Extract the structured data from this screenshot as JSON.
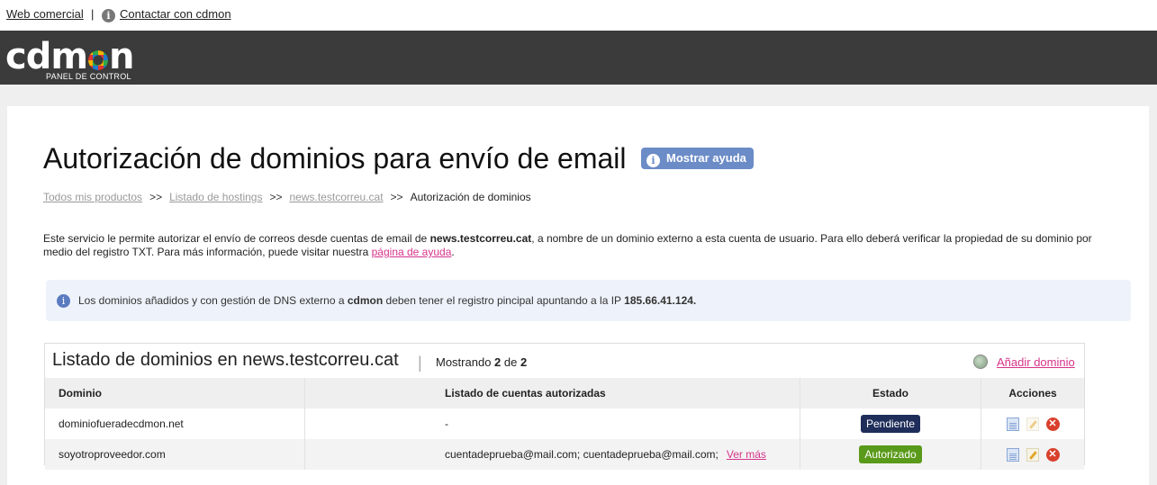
{
  "top_links": {
    "web": "Web comercial",
    "separator": "|",
    "contact": "Contactar con cdmon"
  },
  "header": {
    "logo_left": "cdm",
    "logo_right": "n",
    "subtitle": "PANEL DE CONTROL"
  },
  "page": {
    "title": "Autorización de dominios para envío de email",
    "help_button": "Mostrar ayuda"
  },
  "breadcrumb": {
    "items": [
      "Todos mis productos",
      "Listado de hostings",
      "news.testcorreu.cat"
    ],
    "separator": ">>",
    "current": "Autorización de dominios"
  },
  "description": {
    "part1": "Este servicio le permite autorizar el envío de correos desde cuentas de email de ",
    "domain": "news.testcorreu.cat",
    "part2": ", a nombre de un dominio externo a esta cuenta de usuario. Para ello deberá verificar la propiedad de su dominio por medio del registro TXT. Para más información, puede visitar nuestra ",
    "link": "página de ayuda",
    "part3": "."
  },
  "notice": {
    "part1": "Los dominios añadidos y con gestión de DNS externo a ",
    "brand": "cdmon",
    "part2": " deben tener el registro pincipal apuntando a la IP ",
    "ip": "185.66.41.124",
    "part3": "."
  },
  "list": {
    "title": "Listado de dominios en news.testcorreu.cat",
    "separator": "|",
    "showing_label": "Mostrando",
    "shown": "2",
    "of_label": "de",
    "total": "2",
    "add_label": "Añadir dominio",
    "columns": [
      "Dominio",
      "Listado de cuentas autorizadas",
      "Estado",
      "Acciones"
    ],
    "rows": [
      {
        "domain": "dominiofueradecdmon.net",
        "accounts": "-",
        "more": "",
        "status": "Pendiente",
        "status_color": "#1f2d5a"
      },
      {
        "domain": "soyotroproveedor.com",
        "accounts": "cuentadeprueba@mail.com; cuentadeprueba@mail.com;",
        "more": "Ver más",
        "status": "Autorizado",
        "status_color": "#5a9a1a"
      }
    ]
  },
  "icons": {
    "info": "info-icon",
    "add": "add-domain-icon",
    "view": "document-icon",
    "edit": "edit-icon",
    "delete": "delete-icon"
  }
}
